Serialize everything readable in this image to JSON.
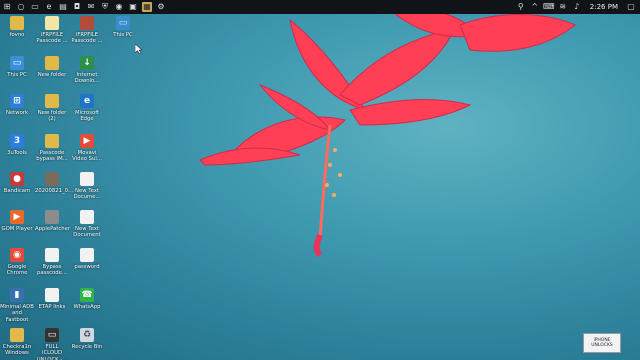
{
  "taskbar": {
    "time": "2:26 PM",
    "pinned_icons": [
      "start-icon",
      "search-icon",
      "task-view-icon",
      "edge-icon",
      "file-explorer-icon",
      "store-icon",
      "mail-icon",
      "security-icon",
      "chrome-icon",
      "photos-icon",
      "gallery-icon",
      "settings-icon"
    ],
    "tray_icons": [
      "network-icon",
      "chevron-up-icon",
      "language-icon",
      "wifi-icon",
      "volume-icon",
      "notification-icon"
    ]
  },
  "desktop": {
    "icons": [
      {
        "label": "fovno",
        "icon": "folder-icon",
        "color": "#e1b84a"
      },
      {
        "label": "iFRPFILE\nPasscode ...",
        "icon": "document-icon",
        "color": "#f0e6a8"
      },
      {
        "label": "iFRPFILE\nPasscode ...",
        "icon": "archive-icon",
        "color": "#b34b3a"
      },
      {
        "label": "This PC",
        "icon": "computer-icon",
        "color": "#3a8fd9"
      },
      {
        "label": "This PC",
        "icon": "computer-icon",
        "color": "#3a8fd9"
      },
      {
        "label": "New folder",
        "icon": "folder-icon",
        "color": "#e1b84a"
      },
      {
        "label": "Internet\nDownlo...",
        "icon": "download-icon",
        "color": "#2d8f4a"
      },
      {
        "label": "Network",
        "icon": "network-icon",
        "color": "#2f7ed8"
      },
      {
        "label": "New folder\n(2)",
        "icon": "folder-icon",
        "color": "#e1b84a"
      },
      {
        "label": "Microsoft\nEdge",
        "icon": "edge-icon",
        "color": "#1f74c8"
      },
      {
        "label": "3uTools",
        "icon": "tools-icon",
        "color": "#2d7de0"
      },
      {
        "label": "Passcode\nbypass IM...",
        "icon": "folder-icon",
        "color": "#e1b84a"
      },
      {
        "label": "Movavi\nVideo Sui...",
        "icon": "video-icon",
        "color": "#e14d3a"
      },
      {
        "label": "Bandicam",
        "icon": "record-icon",
        "color": "#c63a3a"
      },
      {
        "label": "20200821_0...",
        "icon": "file-icon",
        "color": "#7b6b5a"
      },
      {
        "label": "New Text\nDocume...",
        "icon": "text-document-icon",
        "color": "#f2f2f2"
      },
      {
        "label": "GOM Player",
        "icon": "media-player-icon",
        "color": "#e86a2a"
      },
      {
        "label": "ApplePatcher",
        "icon": "patch-icon",
        "color": "#8c8c8c"
      },
      {
        "label": "New Text\nDocument",
        "icon": "text-document-icon",
        "color": "#f2f2f2"
      },
      {
        "label": "Google\nChrome",
        "icon": "chrome-icon",
        "color": "#e14b3b"
      },
      {
        "label": "Bypass\npasscode...",
        "icon": "text-document-icon",
        "color": "#f2f2f2"
      },
      {
        "label": "password",
        "icon": "text-document-icon",
        "color": "#f2f2f2"
      },
      {
        "label": "Minimal ADB\nand Fastboot",
        "icon": "adb-icon",
        "color": "#3a6fb0"
      },
      {
        "label": "ETAP links",
        "icon": "text-document-icon",
        "color": "#f2f2f2"
      },
      {
        "label": "WhatsApp",
        "icon": "whatsapp-icon",
        "color": "#2fb34a"
      },
      {
        "label": "Checkra1n\nWindows",
        "icon": "folder-icon",
        "color": "#e1b84a"
      },
      {
        "label": "FULL iCLOUD\nUNLOCK -...",
        "icon": "monitor-icon",
        "color": "#333333"
      },
      {
        "label": "Recycle Bin",
        "icon": "recycle-bin-icon",
        "color": "#cfd8dc"
      }
    ]
  },
  "watermark": {
    "text": "iPHONE\nUNLOCKS"
  }
}
